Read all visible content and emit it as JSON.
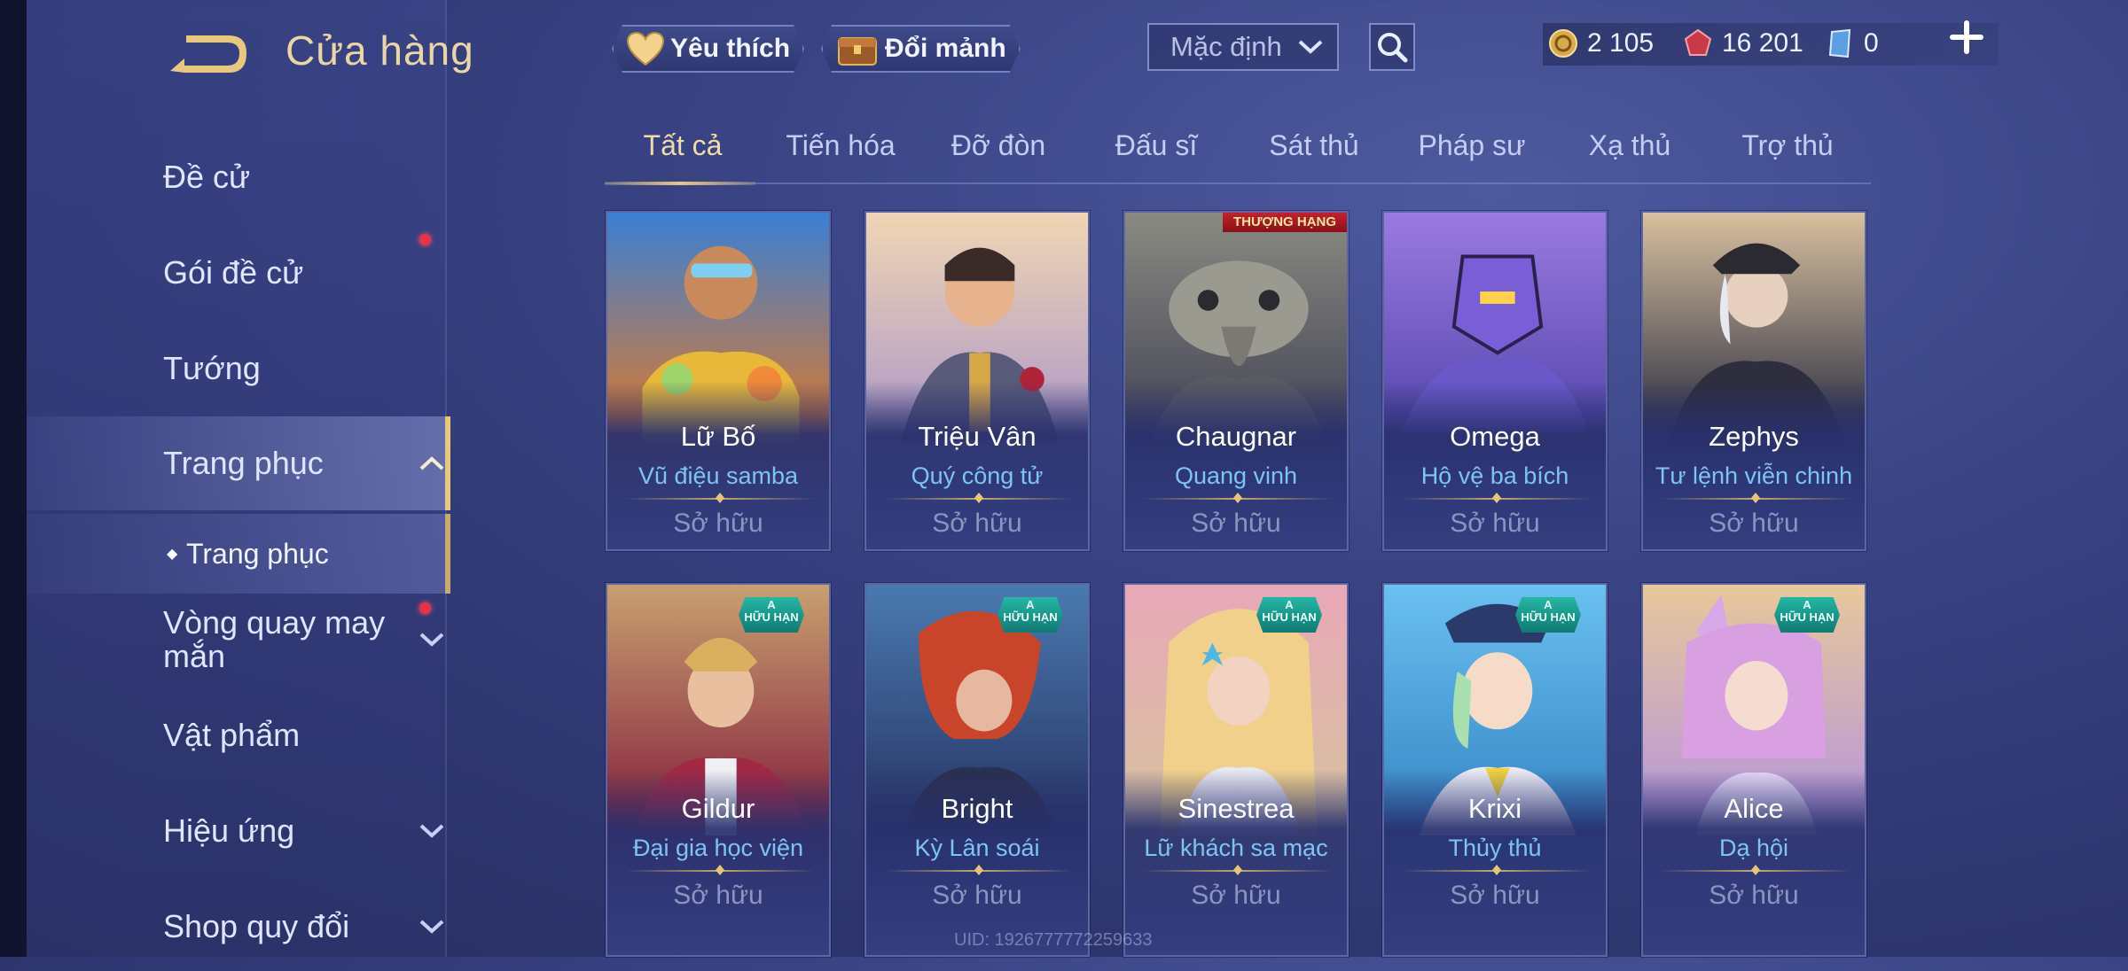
{
  "header": {
    "title": "Cửa hàng",
    "favorite_label": "Yêu thích",
    "exchange_label": "Đổi mảnh",
    "sort_value": "Mặc định"
  },
  "currency": {
    "gold": "2 105",
    "vouchers": "16 201",
    "coupons": "0"
  },
  "sidebar": {
    "items": [
      {
        "label": "Đề cử"
      },
      {
        "label": "Gói đề cử"
      },
      {
        "label": "Tướng"
      },
      {
        "label": "Trang phục"
      },
      {
        "label": "Vòng quay may mắn"
      },
      {
        "label": "Vật phẩm"
      },
      {
        "label": "Hiệu ứng"
      },
      {
        "label": "Shop quy đổi"
      }
    ],
    "sub_item": "Trang phục"
  },
  "tabs": [
    {
      "label": "Tất cả"
    },
    {
      "label": "Tiến hóa"
    },
    {
      "label": "Đỡ đòn"
    },
    {
      "label": "Đấu sĩ"
    },
    {
      "label": "Sát thủ"
    },
    {
      "label": "Pháp sư"
    },
    {
      "label": "Xạ thủ"
    },
    {
      "label": "Trợ thủ"
    }
  ],
  "cards": [
    {
      "hero": "Lữ Bố",
      "skin": "Vũ điệu samba",
      "status": "Sở hữu"
    },
    {
      "hero": "Triệu Vân",
      "skin": "Quý công tử",
      "status": "Sở hữu"
    },
    {
      "hero": "Chaugnar",
      "skin": "Quang vinh",
      "status": "Sở hữu",
      "ribbon": "THƯỢNG HẠNG"
    },
    {
      "hero": "Omega",
      "skin": "Hộ vệ ba bích",
      "status": "Sở hữu"
    },
    {
      "hero": "Zephys",
      "skin": "Tư lệnh viễn chinh",
      "status": "Sở hữu"
    },
    {
      "hero": "Gildur",
      "skin": "Đại gia học viện",
      "status": "Sở hữu",
      "badge": "A\nHỮU HẠN"
    },
    {
      "hero": "Bright",
      "skin": "Kỳ Lân soái",
      "status": "Sở hữu",
      "badge": "A\nHỮU HẠN"
    },
    {
      "hero": "Sinestrea",
      "skin": "Lữ khách sa mạc",
      "status": "Sở hữu",
      "badge": "A\nHỮU HẠN"
    },
    {
      "hero": "Krixi",
      "skin": "Thủy thủ",
      "status": "Sở hữu",
      "badge": "A\nHỮU HẠN"
    },
    {
      "hero": "Alice",
      "skin": "Dạ hội",
      "status": "Sở hữu",
      "badge": "A\nHỮU HẠN"
    }
  ],
  "uid_text": "UID: 1926777772259633",
  "colors": {
    "accent_gold": "#e7c97c",
    "skin_name_blue": "#7ec4f2",
    "notification_red": "#e53445"
  }
}
